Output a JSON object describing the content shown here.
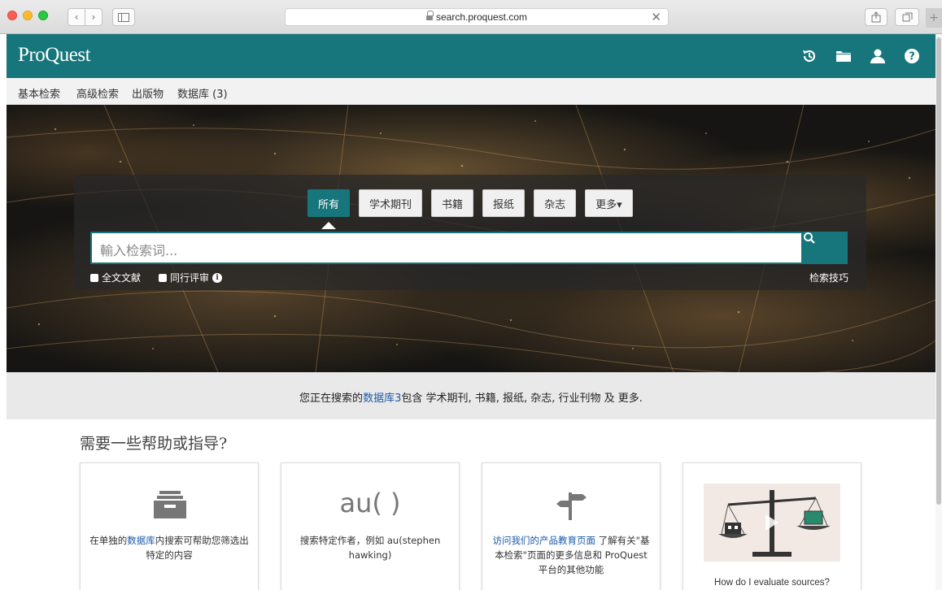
{
  "browser": {
    "url": "search.proquest.com",
    "plus_label": "+"
  },
  "header": {
    "logo": "ProQuest",
    "icons": [
      "history-icon",
      "folder-icon",
      "user-icon",
      "help-icon"
    ]
  },
  "nav": {
    "items": [
      "基本检索",
      "高级检索",
      "出版物",
      "数据库 (3)"
    ],
    "active": "基本检索"
  },
  "search": {
    "tabs": [
      "所有",
      "学术期刊",
      "书籍",
      "报纸",
      "杂志",
      "更多▾"
    ],
    "active_tab": "所有",
    "placeholder": "輸入检索词...",
    "fulltext_label": "全文文献",
    "peer_review_label": "同行评审",
    "tips_label": "检索技巧"
  },
  "info_strip": {
    "prefix": "您正在搜索的",
    "link": "数据库3",
    "suffix": "包含 学术期刊, 书籍, 报纸, 杂志, 行业刊物 及 更多."
  },
  "help": {
    "title": "需要一些帮助或指导?",
    "cards": [
      {
        "icon": "inbox-tray-icon",
        "text_a": "在单独的",
        "link": "数据库",
        "text_b": "内搜索可帮助您筛选出特定的内容"
      },
      {
        "icon_text": "au( )",
        "text": "搜索特定作者，例如 au(stephen hawking)"
      },
      {
        "icon": "signpost-icon",
        "link": "访问我们的产品教育页面",
        "text": " 了解有关\"基本检索\"页面的更多信息和 ProQuest 平台的其他功能"
      },
      {
        "icon": "scale-video-icon",
        "text": "How do I evaluate sources?"
      }
    ]
  },
  "colors": {
    "brand": "#16767b",
    "link": "#1a5aa8"
  }
}
